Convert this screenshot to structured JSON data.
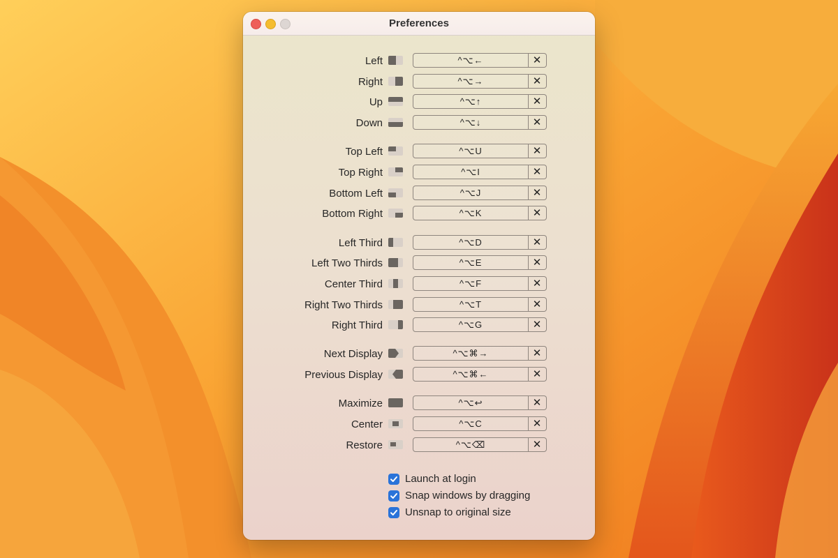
{
  "window": {
    "title": "Preferences"
  },
  "shortcuts": [
    {
      "label": "Left",
      "keys": "^⌥←",
      "icon": "left-half-icon"
    },
    {
      "label": "Right",
      "keys": "^⌥→",
      "icon": "right-half-icon"
    },
    {
      "label": "Up",
      "keys": "^⌥↑",
      "icon": "top-half-icon"
    },
    {
      "label": "Down",
      "keys": "^⌥↓",
      "icon": "bottom-half-icon"
    },
    {
      "label": "Top Left",
      "keys": "^⌥U",
      "icon": "top-left-quarter-icon"
    },
    {
      "label": "Top Right",
      "keys": "^⌥I",
      "icon": "top-right-quarter-icon"
    },
    {
      "label": "Bottom Left",
      "keys": "^⌥J",
      "icon": "bottom-left-quarter-icon"
    },
    {
      "label": "Bottom Right",
      "keys": "^⌥K",
      "icon": "bottom-right-quarter-icon"
    },
    {
      "label": "Left Third",
      "keys": "^⌥D",
      "icon": "left-third-icon"
    },
    {
      "label": "Left Two Thirds",
      "keys": "^⌥E",
      "icon": "left-two-thirds-icon"
    },
    {
      "label": "Center Third",
      "keys": "^⌥F",
      "icon": "center-third-icon"
    },
    {
      "label": "Right Two Thirds",
      "keys": "^⌥T",
      "icon": "right-two-thirds-icon"
    },
    {
      "label": "Right Third",
      "keys": "^⌥G",
      "icon": "right-third-icon"
    },
    {
      "label": "Next Display",
      "keys": "^⌥⌘→",
      "icon": "next-display-icon"
    },
    {
      "label": "Previous Display",
      "keys": "^⌥⌘←",
      "icon": "previous-display-icon"
    },
    {
      "label": "Maximize",
      "keys": "^⌥↩",
      "icon": "maximize-icon"
    },
    {
      "label": "Center",
      "keys": "^⌥C",
      "icon": "center-icon"
    },
    {
      "label": "Restore",
      "keys": "^⌥⌫",
      "icon": "restore-icon"
    }
  ],
  "clear_glyph": "✕",
  "options": [
    {
      "label": "Launch at login",
      "checked": true
    },
    {
      "label": "Snap windows by dragging",
      "checked": true
    },
    {
      "label": "Unsnap to original size",
      "checked": true
    }
  ],
  "colors": {
    "accent": "#2a73d9",
    "window_bg": "#ece0cf"
  }
}
